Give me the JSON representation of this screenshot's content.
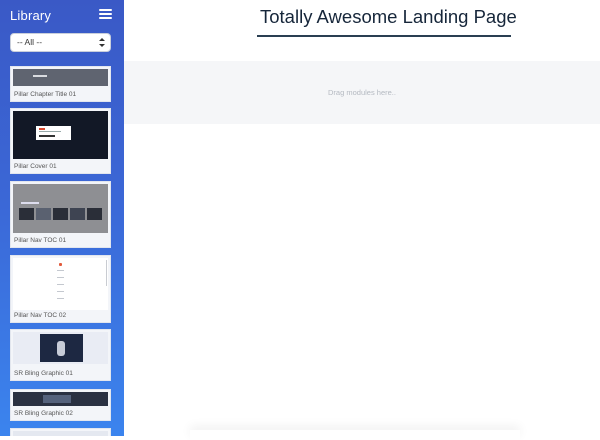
{
  "sidebar": {
    "title": "Library",
    "menu_icon": "hamburger-menu-icon",
    "filter": {
      "selected": "-- All --"
    },
    "modules": [
      {
        "name": "Pillar Chapter Title 01"
      },
      {
        "name": "Pillar Cover 01"
      },
      {
        "name": "Pillar Nav TOC 01"
      },
      {
        "name": "Pillar Nav TOC 02"
      },
      {
        "name": "SR Bling Graphic 01"
      },
      {
        "name": "SR Bling Graphic 02"
      }
    ]
  },
  "main": {
    "page_title": "Totally Awesome Landing Page",
    "dropzone_text": "Drag modules here.."
  },
  "colors": {
    "sidebar_top": "#3a59c6",
    "sidebar_bottom": "#3b84ee",
    "title_text": "#16263a",
    "title_underline": "#2a3f52"
  }
}
